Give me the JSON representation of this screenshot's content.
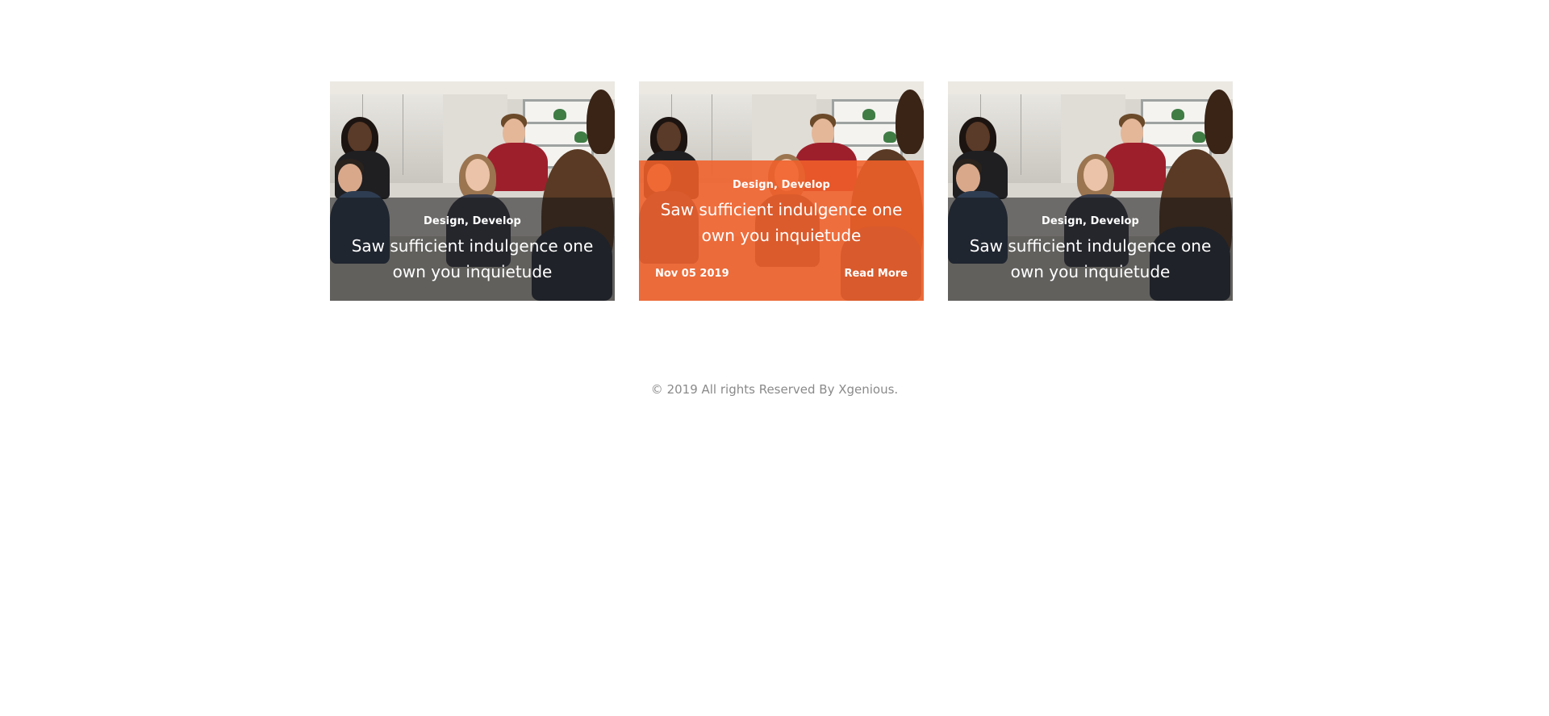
{
  "posts": [
    {
      "categories": "Design, Develop",
      "title": "Saw sufficient indulgence one own you inquietude",
      "date": "",
      "read_more": ""
    },
    {
      "categories": "Design, Develop",
      "title": "Saw sufficient indulgence one own you inquietude",
      "date": "Nov 05 2019",
      "read_more": "Read More"
    },
    {
      "categories": "Design, Develop",
      "title": "Saw sufficient indulgence one own you inquietude",
      "date": "",
      "read_more": ""
    }
  ],
  "colors": {
    "accent": "#f16029",
    "overlay": "#141414",
    "footer_text": "#8a8a8a"
  },
  "footer": {
    "copyright": "© 2019 All rights Reserved By Xgenious."
  }
}
